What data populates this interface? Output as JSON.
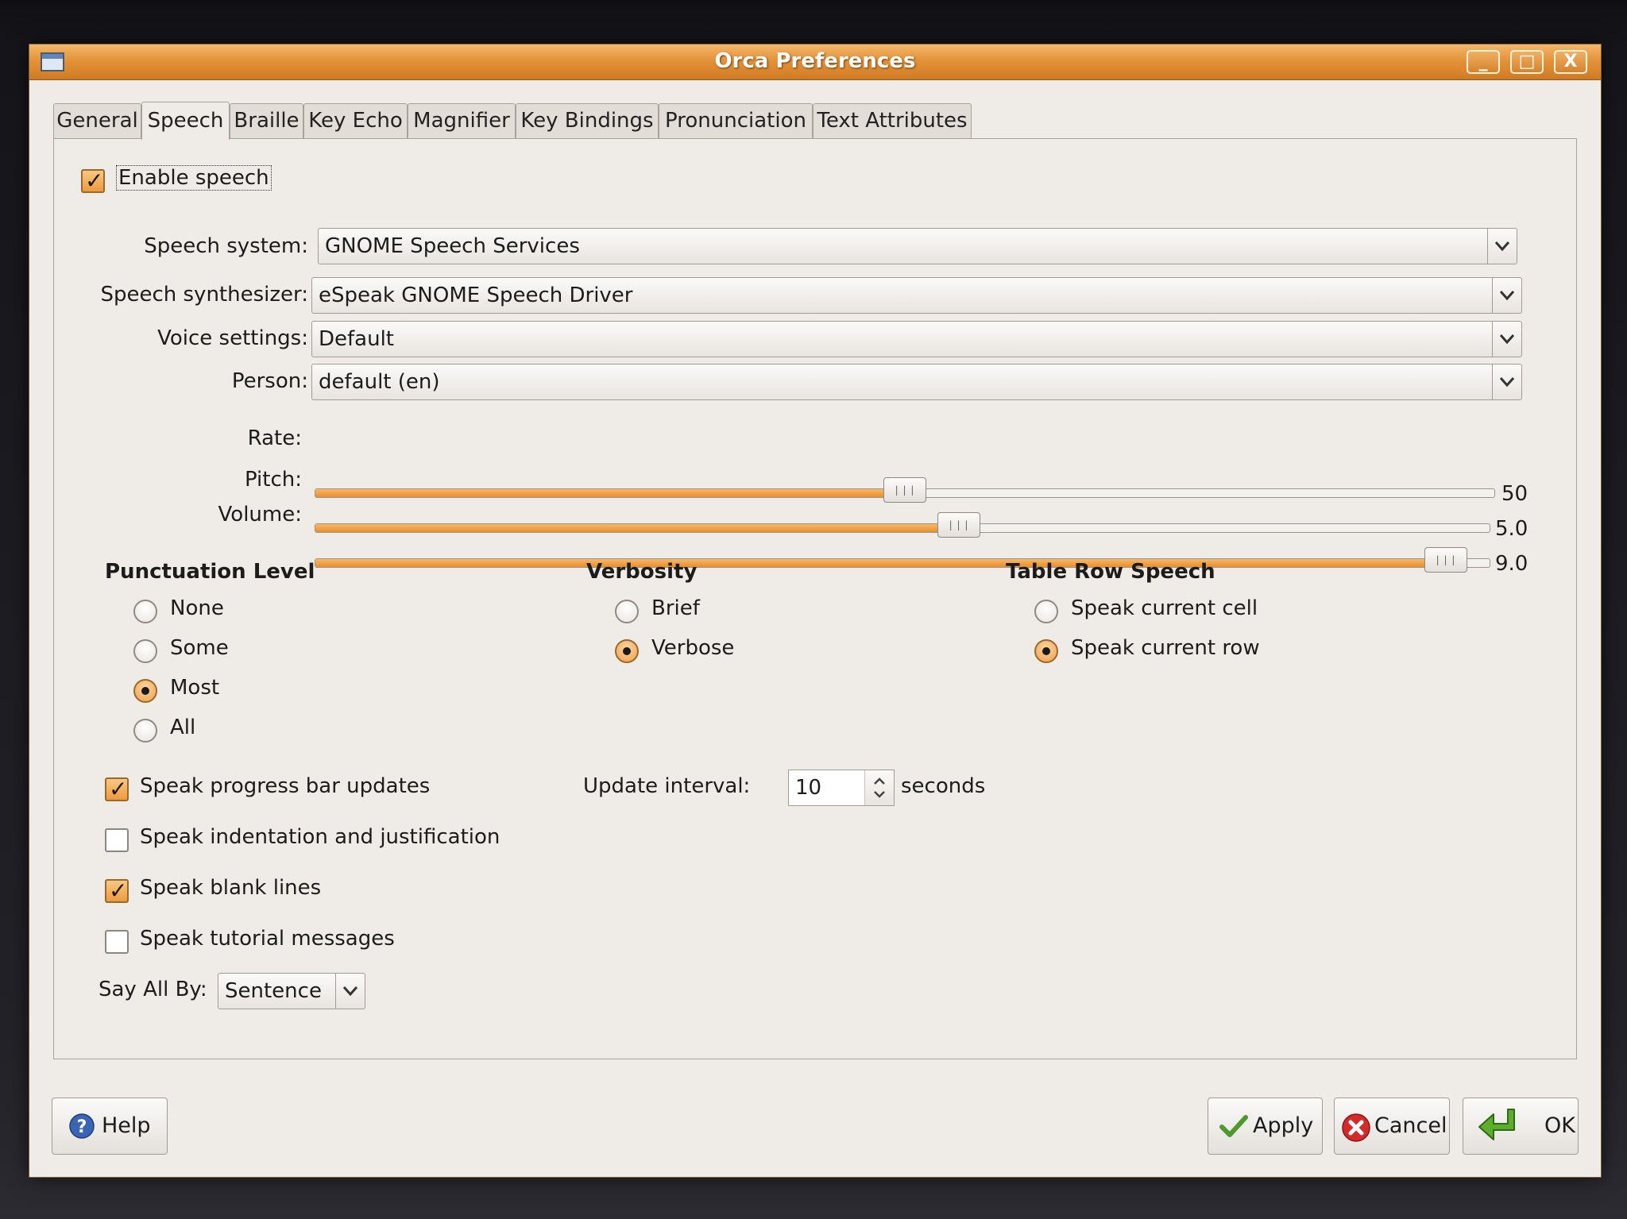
{
  "window": {
    "title": "Orca Preferences",
    "controls": {
      "minimize": "_",
      "maximize": "□",
      "close": "X"
    }
  },
  "tabs": [
    {
      "label": "General"
    },
    {
      "label": "Speech",
      "active": true
    },
    {
      "label": "Braille"
    },
    {
      "label": "Key Echo"
    },
    {
      "label": "Magnifier"
    },
    {
      "label": "Key Bindings"
    },
    {
      "label": "Pronunciation"
    },
    {
      "label": "Text Attributes"
    }
  ],
  "speech": {
    "enable_speech": {
      "label": "Enable speech",
      "checked": true
    },
    "speech_system": {
      "label": "Speech system:",
      "value": "GNOME Speech Services"
    },
    "speech_synthesizer": {
      "label": "Speech synthesizer:",
      "value": "eSpeak GNOME Speech Driver"
    },
    "voice_settings": {
      "label": "Voice settings:",
      "value": "Default"
    },
    "person": {
      "label": "Person:",
      "value": "default (en)"
    },
    "rate": {
      "label": "Rate:",
      "value_text": "50",
      "fraction": 0.5
    },
    "pitch": {
      "label": "Pitch:",
      "value_text": "5.0",
      "fraction": 0.55
    },
    "volume": {
      "label": "Volume:",
      "value_text": "9.0",
      "fraction": 0.98
    }
  },
  "punctuation": {
    "heading": "Punctuation Level",
    "options": [
      {
        "label": "None",
        "selected": false
      },
      {
        "label": "Some",
        "selected": false
      },
      {
        "label": "Most",
        "selected": true
      },
      {
        "label": "All",
        "selected": false
      }
    ]
  },
  "verbosity": {
    "heading": "Verbosity",
    "options": [
      {
        "label": "Brief",
        "selected": false
      },
      {
        "label": "Verbose",
        "selected": true
      }
    ]
  },
  "table_row": {
    "heading": "Table Row Speech",
    "options": [
      {
        "label": "Speak current cell",
        "selected": false
      },
      {
        "label": "Speak current row",
        "selected": true
      }
    ]
  },
  "checks": [
    {
      "label": "Speak progress bar updates",
      "checked": true
    },
    {
      "label": "Speak indentation and justification",
      "checked": false
    },
    {
      "label": "Speak blank lines",
      "checked": true
    },
    {
      "label": "Speak tutorial messages",
      "checked": false
    }
  ],
  "update_interval": {
    "label": "Update interval:",
    "value": "10",
    "unit": "seconds"
  },
  "say_all_by": {
    "label": "Say All By:",
    "value": "Sentence"
  },
  "buttons": {
    "help": "Help",
    "apply": "Apply",
    "cancel": "Cancel",
    "ok": "OK"
  }
}
